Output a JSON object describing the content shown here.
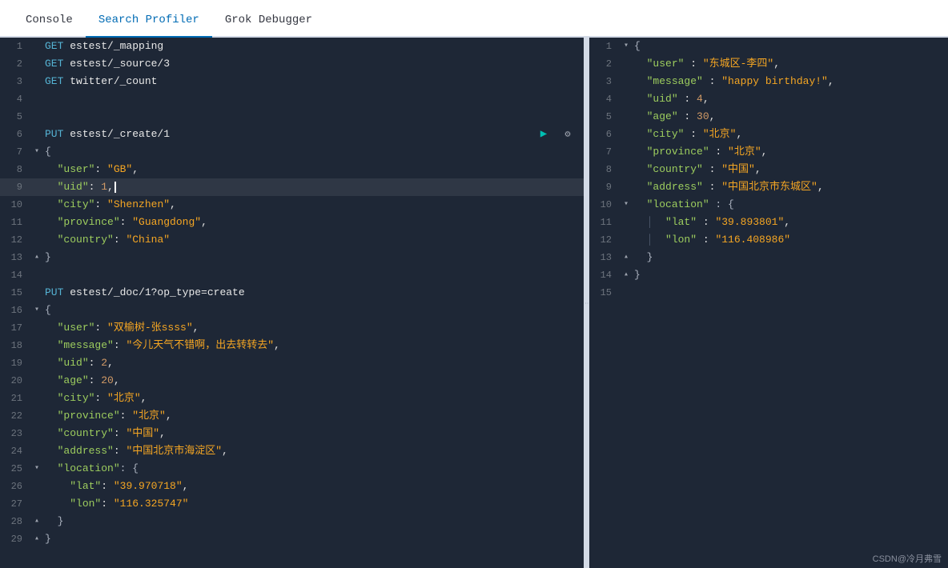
{
  "tabs": [
    {
      "label": "Console",
      "active": false
    },
    {
      "label": "Search Profiler",
      "active": true
    },
    {
      "label": "Grok Debugger",
      "active": false
    }
  ],
  "editor": {
    "lines": [
      {
        "num": 1,
        "fold": " ",
        "content": "GET estest/_mapping",
        "type": "method-path",
        "method": "GET",
        "path": "estest/_mapping"
      },
      {
        "num": 2,
        "fold": " ",
        "content": "GET estest/_source/3",
        "type": "method-path",
        "method": "GET",
        "path": "estest/_source/3"
      },
      {
        "num": 3,
        "fold": " ",
        "content": "GET twitter/_count",
        "type": "method-path",
        "method": "GET",
        "path": "twitter/_count"
      },
      {
        "num": 4,
        "fold": " ",
        "content": "",
        "type": "empty"
      },
      {
        "num": 5,
        "fold": " ",
        "content": "",
        "type": "empty"
      },
      {
        "num": 6,
        "fold": " ",
        "content": "PUT estest/_create/1",
        "type": "method-path",
        "method": "PUT",
        "path": "estest/_create/1",
        "has_actions": true
      },
      {
        "num": 7,
        "fold": "▾",
        "content": "{",
        "type": "punc"
      },
      {
        "num": 8,
        "fold": " ",
        "content": "  \"user\": \"GB\",",
        "type": "json-kv",
        "key": "user",
        "val": "GB",
        "has_comma": true
      },
      {
        "num": 9,
        "fold": " ",
        "content": "  \"uid\": 1,",
        "type": "json-kv-num",
        "key": "uid",
        "val": "1",
        "has_comma": true,
        "highlighted": true
      },
      {
        "num": 10,
        "fold": " ",
        "content": "  \"city\": \"Shenzhen\",",
        "type": "json-kv",
        "key": "city",
        "val": "Shenzhen",
        "has_comma": true
      },
      {
        "num": 11,
        "fold": " ",
        "content": "  \"province\": \"Guangdong\",",
        "type": "json-kv",
        "key": "province",
        "val": "Guangdong",
        "has_comma": true
      },
      {
        "num": 12,
        "fold": " ",
        "content": "  \"country\": \"China\"",
        "type": "json-kv",
        "key": "country",
        "val": "China",
        "has_comma": false
      },
      {
        "num": 13,
        "fold": "▴",
        "content": "}",
        "type": "punc"
      },
      {
        "num": 14,
        "fold": " ",
        "content": "",
        "type": "empty"
      },
      {
        "num": 15,
        "fold": " ",
        "content": "PUT estest/_doc/1?op_type=create",
        "type": "method-path",
        "method": "PUT",
        "path": "estest/_doc/1?op_type=create"
      },
      {
        "num": 16,
        "fold": "▾",
        "content": "{",
        "type": "punc"
      },
      {
        "num": 17,
        "fold": " ",
        "content": "  \"user\": \"双榆树-张ssss\",",
        "type": "json-kv",
        "key": "user",
        "val": "双榆树-张ssss",
        "has_comma": true
      },
      {
        "num": 18,
        "fold": " ",
        "content": "  \"message\": \"今儿天气不错啊，出去转转去\",",
        "type": "json-kv",
        "key": "message",
        "val": "今儿天气不错啊，出去转转去",
        "has_comma": true
      },
      {
        "num": 19,
        "fold": " ",
        "content": "  \"uid\": 2,",
        "type": "json-kv-num",
        "key": "uid",
        "val": "2",
        "has_comma": true
      },
      {
        "num": 20,
        "fold": " ",
        "content": "  \"age\": 20,",
        "type": "json-kv-num",
        "key": "age",
        "val": "20",
        "has_comma": true
      },
      {
        "num": 21,
        "fold": " ",
        "content": "  \"city\": \"北京\",",
        "type": "json-kv",
        "key": "city",
        "val": "北京",
        "has_comma": true
      },
      {
        "num": 22,
        "fold": " ",
        "content": "  \"province\": \"北京\",",
        "type": "json-kv",
        "key": "province",
        "val": "北京",
        "has_comma": true
      },
      {
        "num": 23,
        "fold": " ",
        "content": "  \"country\": \"中国\",",
        "type": "json-kv",
        "key": "country",
        "val": "中国",
        "has_comma": true
      },
      {
        "num": 24,
        "fold": " ",
        "content": "  \"address\": \"中国北京市海淀区\",",
        "type": "json-kv",
        "key": "address",
        "val": "中国北京市海淀区",
        "has_comma": true
      },
      {
        "num": 25,
        "fold": "▾",
        "content": "  \"location\": {",
        "type": "json-kv-obj",
        "key": "location"
      },
      {
        "num": 26,
        "fold": " ",
        "content": "    \"lat\": \"39.970718\",",
        "type": "json-kv-nested",
        "key": "lat",
        "val": "39.970718",
        "has_comma": true
      },
      {
        "num": 27,
        "fold": " ",
        "content": "    \"lon\": \"116.325747\"",
        "type": "json-kv-nested",
        "key": "lon",
        "val": "116.325747"
      },
      {
        "num": 28,
        "fold": "▴",
        "content": "  }",
        "type": "punc-indent"
      },
      {
        "num": 29,
        "fold": "▴",
        "content": "}",
        "type": "punc"
      }
    ]
  },
  "response": {
    "lines": [
      {
        "num": 1,
        "fold": "▾",
        "content": "{"
      },
      {
        "num": 2,
        "fold": " ",
        "key": "user",
        "val": "东城区-李四",
        "type": "kv-str"
      },
      {
        "num": 3,
        "fold": " ",
        "key": "message",
        "val": "happy birthday!",
        "type": "kv-str"
      },
      {
        "num": 4,
        "fold": " ",
        "key": "uid",
        "val": "4",
        "type": "kv-num"
      },
      {
        "num": 5,
        "fold": " ",
        "key": "age",
        "val": "30",
        "type": "kv-num"
      },
      {
        "num": 6,
        "fold": " ",
        "key": "city",
        "val": "北京",
        "type": "kv-str"
      },
      {
        "num": 7,
        "fold": " ",
        "key": "province",
        "val": "北京",
        "type": "kv-str"
      },
      {
        "num": 8,
        "fold": " ",
        "key": "country",
        "val": "中国",
        "type": "kv-str"
      },
      {
        "num": 9,
        "fold": " ",
        "key": "address",
        "val": "中国北京市东城区",
        "type": "kv-str"
      },
      {
        "num": 10,
        "fold": "▾",
        "key": "location",
        "val": "",
        "type": "kv-obj"
      },
      {
        "num": 11,
        "fold": " ",
        "key": "lat",
        "val": "39.893801",
        "type": "kv-str-nested"
      },
      {
        "num": 12,
        "fold": " ",
        "key": "lon",
        "val": "116.408986",
        "type": "kv-str-nested"
      },
      {
        "num": 13,
        "fold": "▴",
        "content": "  }"
      },
      {
        "num": 14,
        "fold": "▴",
        "content": "}"
      },
      {
        "num": 15,
        "fold": " ",
        "content": ""
      }
    ]
  },
  "watermark": "CSDN@冷月弗雪"
}
